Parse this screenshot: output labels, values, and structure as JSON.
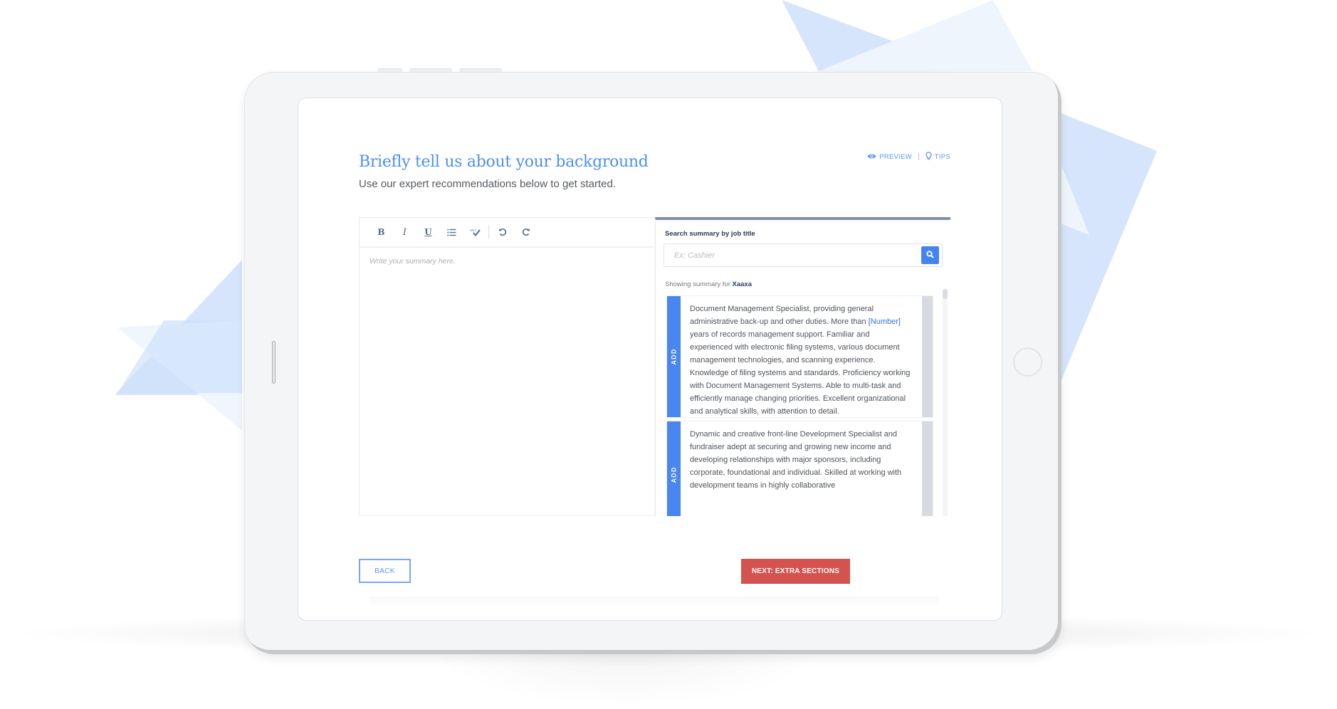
{
  "page": {
    "title": "Briefly tell us about your background",
    "subtitle": "Use our expert recommendations below to get started."
  },
  "top_links": {
    "preview": {
      "label": "PREVIEW",
      "icon": "eye-icon"
    },
    "separator": "|",
    "tips": {
      "label": "TIPS",
      "icon": "lightbulb-icon"
    }
  },
  "editor": {
    "toolbar": [
      {
        "name": "bold",
        "glyph": "B",
        "icon": "bold-icon"
      },
      {
        "name": "italic",
        "glyph": "I",
        "icon": "italic-icon"
      },
      {
        "name": "underline",
        "glyph": "U",
        "icon": "underline-icon"
      },
      {
        "name": "bullet-list",
        "icon": "list-icon"
      },
      {
        "name": "spellcheck",
        "icon": "spellcheck-icon"
      },
      {
        "name": "undo",
        "icon": "undo-icon"
      },
      {
        "name": "redo",
        "icon": "redo-icon"
      }
    ],
    "placeholder": "Write your summary here.",
    "value": ""
  },
  "search_panel": {
    "label": "Search summary by job title",
    "placeholder": "Ex: Cashier",
    "value": "",
    "showing_prefix": "Showing summary for",
    "showing_job": "Xaaxa",
    "add_label": "ADD",
    "cards": [
      {
        "before": "Document Management Specialist, providing general administrative back-up and other duties. More than ",
        "placeholder": "[Number]",
        "after": " years of records management support. Familiar and experienced with electronic filing systems, various document management technologies, and scanning experience. Knowledge of filing systems and standards. Proficiency working with Document Management Systems. Able to multi-task and efficiently manage changing priorities. Excellent organizational and analytical skills, with attention to detail."
      },
      {
        "before": "Dynamic and creative front-line Development Specialist and fundraiser adept at securing and growing new income and developing relationships with major sponsors, including corporate, foundational and individual. Skilled at working with development teams in highly collaborative",
        "placeholder": "",
        "after": ""
      }
    ]
  },
  "footer": {
    "back_label": "BACK",
    "next_label": "NEXT: EXTRA SECTIONS"
  },
  "colors": {
    "accent": "#4d8ff0",
    "primary_button": "#d4534f",
    "add_bar": "#4a86ef",
    "panel_top_border": "#7f90a8"
  }
}
